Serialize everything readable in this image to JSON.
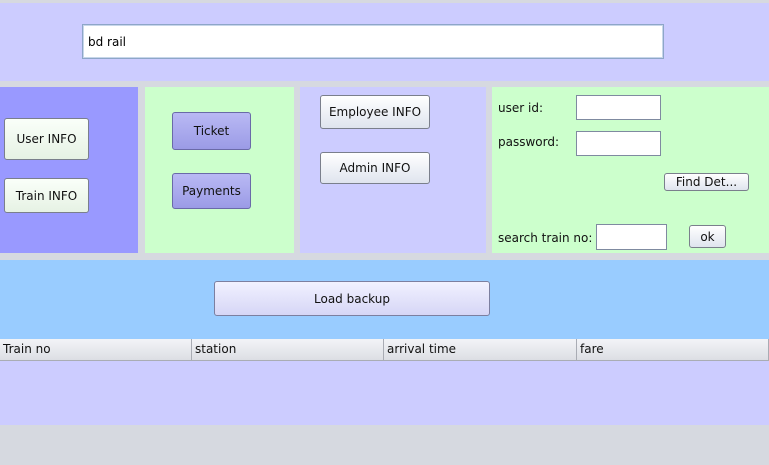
{
  "header": {
    "search_value": "bd rail"
  },
  "left_panel": {
    "user_info_label": "User INFO",
    "train_info_label": "Train INFO"
  },
  "ticket_panel": {
    "ticket_label": "Ticket",
    "payments_label": "Payments"
  },
  "staff_panel": {
    "employee_info_label": "Employee INFO",
    "admin_info_label": "Admin INFO"
  },
  "login_panel": {
    "user_id_label": "user id:",
    "user_id_value": "",
    "password_label": "password:",
    "password_value": "",
    "find_button_label": "Find Det...",
    "search_train_label": "search train no:",
    "search_train_value": "",
    "ok_button_label": "ok"
  },
  "backup": {
    "load_backup_label": "Load backup"
  },
  "table": {
    "columns": [
      "Train no",
      "station",
      "arrival time",
      "fare"
    ],
    "rows": []
  },
  "colors": {
    "header_bg": "#ccccff",
    "left_panel_bg": "#9999ff",
    "green_panel_bg": "#ccffcc",
    "backup_bg": "#99ccff",
    "table_body_bg": "#ccccff"
  }
}
